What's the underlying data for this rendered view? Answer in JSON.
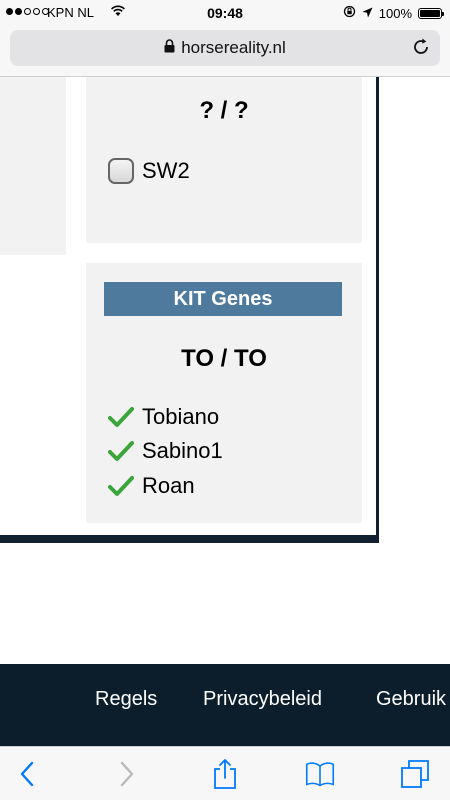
{
  "status_bar": {
    "carrier": "KPN NL",
    "time": "09:48",
    "battery": "100%"
  },
  "browser": {
    "url": "horsereality.nl"
  },
  "extension_panel": {
    "genotype": "? / ?",
    "genes": [
      {
        "label": "SW2",
        "checked": false
      }
    ]
  },
  "kit_panel": {
    "title": "KIT Genes",
    "genotype": "TO / TO",
    "genes": [
      {
        "label": "Tobiano",
        "checked": true
      },
      {
        "label": "Sabino1",
        "checked": true
      },
      {
        "label": "Roan",
        "checked": true
      }
    ]
  },
  "footer": {
    "links": [
      "Regels",
      "Privacybeleid",
      "Gebruik"
    ]
  },
  "colors": {
    "kit_header": "#4e7a9d",
    "footer_bg": "#0c1e2c",
    "ios_blue": "#007aff",
    "check_green": "#3aa53a"
  },
  "icons": [
    "wifi-icon",
    "location-arrow-icon",
    "rotation-lock-icon",
    "lock-icon",
    "reload-icon",
    "back-icon",
    "forward-icon",
    "share-icon",
    "bookmarks-icon",
    "tabs-icon"
  ]
}
